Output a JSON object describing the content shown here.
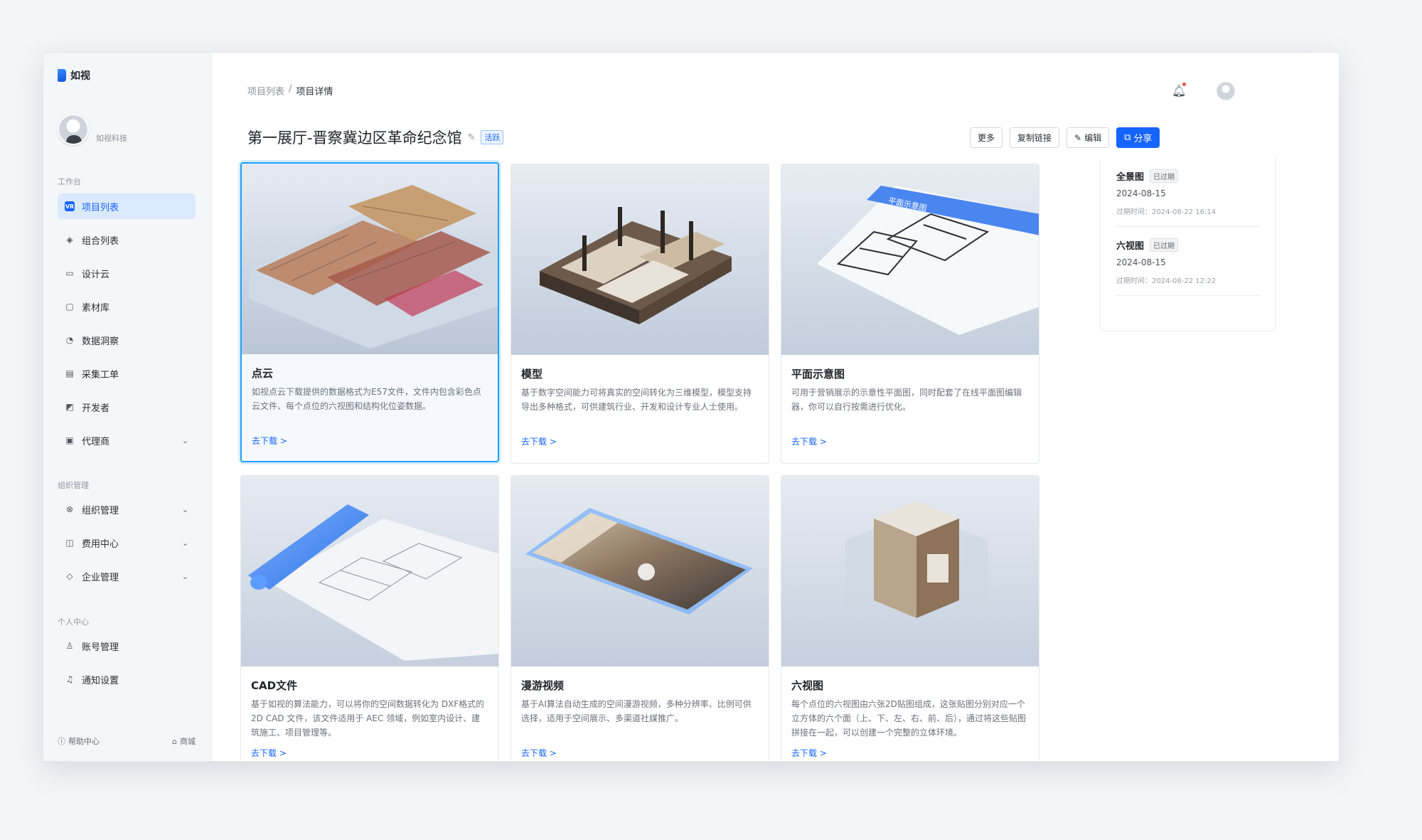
{
  "app": {
    "logo_text": "如视",
    "company": "如视科技"
  },
  "sidebar": {
    "section_workbench": "工作台",
    "section_org": "组织管理",
    "section_personal": "个人中心",
    "items": [
      {
        "label": "项目列表",
        "icon": "project-icon"
      },
      {
        "label": "组合列表",
        "icon": "layers-icon"
      },
      {
        "label": "设计云",
        "icon": "design-icon"
      },
      {
        "label": "素材库",
        "icon": "folder-icon"
      },
      {
        "label": "数据洞察",
        "icon": "chart-icon"
      },
      {
        "label": "采集工单",
        "icon": "document-icon"
      },
      {
        "label": "开发者",
        "icon": "code-icon"
      },
      {
        "label": "代理商",
        "icon": "briefcase-icon"
      },
      {
        "label": "组织管理",
        "icon": "org-icon"
      },
      {
        "label": "费用中心",
        "icon": "wallet-icon"
      },
      {
        "label": "企业管理",
        "icon": "shield-icon"
      },
      {
        "label": "账号管理",
        "icon": "user-icon"
      },
      {
        "label": "通知设置",
        "icon": "bell-icon"
      }
    ],
    "help_label": "帮助中心",
    "store_label": "商城"
  },
  "header": {
    "breadcrumb_parent": "项目列表",
    "breadcrumb_sep": "/",
    "breadcrumb_current": "项目详情",
    "title": "第一展厅-晋察冀边区革命纪念馆",
    "status_badge": "活跃"
  },
  "actions": {
    "more": "更多",
    "copy_link": "复制链接",
    "edit": "编辑",
    "share": "分享"
  },
  "cards": [
    {
      "title": "点云",
      "desc": "如视点云下载提供的数据格式为E57文件，文件内包含彩色点云文件、每个点位的六视图和结构化位姿数据。",
      "link": "去下载 >"
    },
    {
      "title": "模型",
      "desc": "基于数字空间能力可将真实的空间转化为三维模型，模型支持导出多种格式，可供建筑行业、开发和设计专业人士使用。",
      "link": "去下载 >"
    },
    {
      "title": "平面示意图",
      "desc": "可用于营销展示的示意性平面图，同时配套了在线平面图编辑器，你可以自行按需进行优化。",
      "link": "去下载 >",
      "thumb_text": "平面示意图"
    },
    {
      "title": "CAD文件",
      "desc": "基于如视的算法能力，可以将你的空间数据转化为 DXF格式的 2D CAD 文件，该文件适用于 AEC 领域，例如室内设计、建筑施工、项目管理等。",
      "link": "去下载 >"
    },
    {
      "title": "漫游视频",
      "desc": "基于AI算法自动生成的空间漫游视频，多种分辨率、比例可供选择，适用于空间展示、多渠道社媒推广。",
      "link": "去下载 >"
    },
    {
      "title": "六视图",
      "desc": "每个点位的六视图由六张2D贴图组成，这张贴图分别对应一个立方体的六个面（上、下、左、右、前、后），通过将这些贴图拼接在一起，可以创建一个完整的立体环境。",
      "link": "去下载 >"
    }
  ],
  "panel": [
    {
      "title": "全景图",
      "tag": "已过期",
      "date": "2024-08-15",
      "expire": "过期时间：2024-08-22 16:14"
    },
    {
      "title": "六视图",
      "tag": "已过期",
      "date": "2024-08-15",
      "expire": "过期时间：2024-08-22 12:22"
    }
  ],
  "colors": {
    "accent": "#1664ff",
    "selected_border": "#1ea0ff",
    "sidebar_bg": "#f5f6f8"
  }
}
